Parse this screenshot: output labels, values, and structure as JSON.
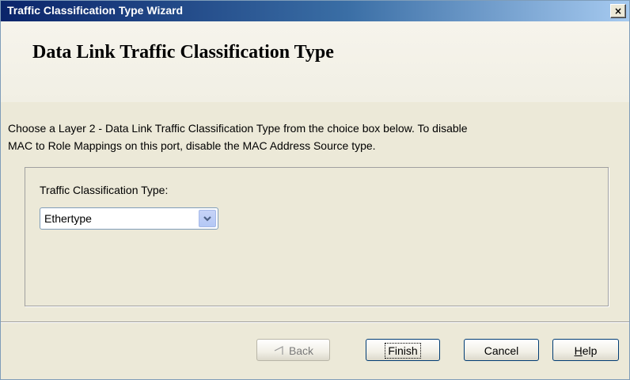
{
  "window": {
    "title": "Traffic Classification Type Wizard",
    "close_glyph": "×"
  },
  "header": {
    "title": "Data Link Traffic Classification Type"
  },
  "instructions": {
    "line1": "Choose a Layer 2 - Data Link Traffic Classification Type from the choice box below.  To disable",
    "line2": "MAC to Role Mappings on this port, disable the MAC Address Source type."
  },
  "form": {
    "label": "Traffic Classification Type:",
    "selected": "Ethertype"
  },
  "buttons": {
    "back": {
      "icon": "back-arrow-icon",
      "label": "Back"
    },
    "finish": "Finish",
    "cancel": "Cancel",
    "help_mnemonic": "H",
    "help_rest": "elp"
  },
  "colors": {
    "title_gradient_start": "#0a246a",
    "title_gradient_end": "#a6caf0",
    "dialog_bg": "#ece9d8"
  }
}
